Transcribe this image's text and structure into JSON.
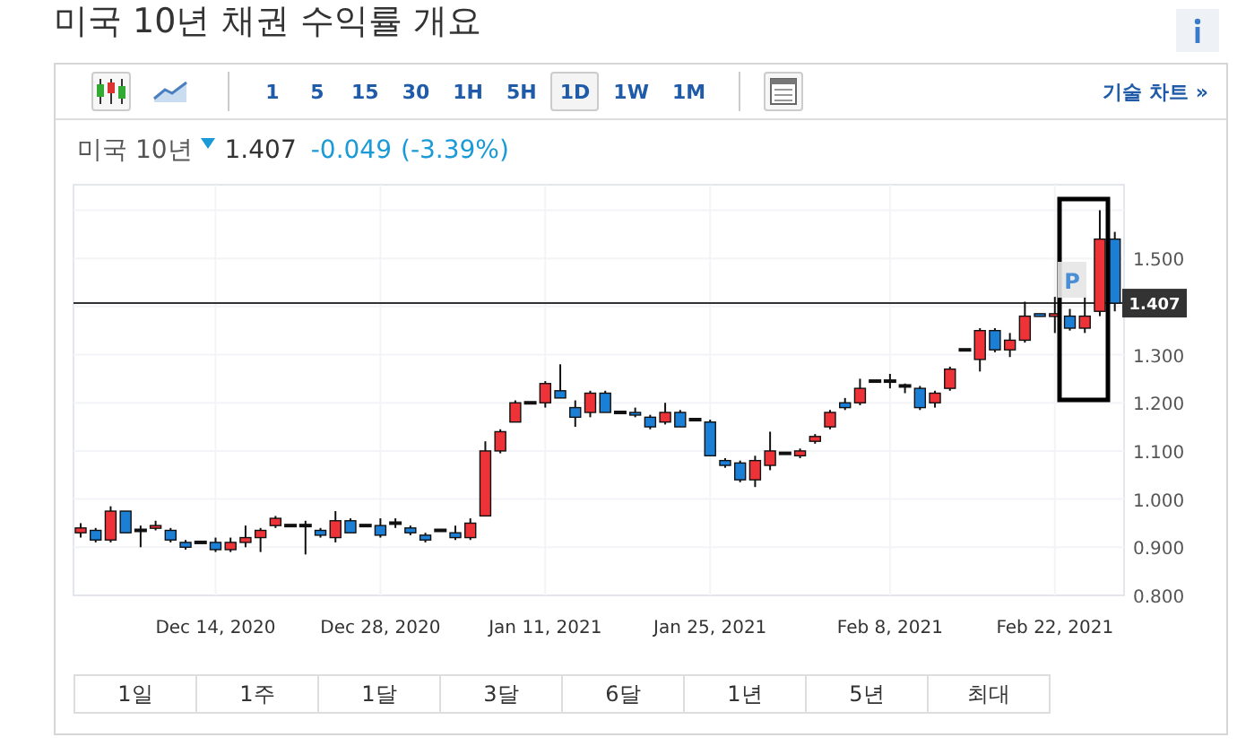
{
  "title": "미국 10년 채권 수익률 개요",
  "toolbar": {
    "chart_types": [
      {
        "kind": "candlestick",
        "selected": true
      },
      {
        "kind": "line",
        "selected": false
      }
    ],
    "intervals": [
      {
        "label": "1",
        "selected": false
      },
      {
        "label": "5",
        "selected": false
      },
      {
        "label": "15",
        "selected": false
      },
      {
        "label": "30",
        "selected": false
      },
      {
        "label": "1H",
        "selected": false
      },
      {
        "label": "5H",
        "selected": false
      },
      {
        "label": "1D",
        "selected": true
      },
      {
        "label": "1W",
        "selected": false
      },
      {
        "label": "1M",
        "selected": false
      }
    ],
    "technical_link": "기술 차트 »"
  },
  "quote": {
    "name": "미국 10년",
    "falling": true,
    "price": "1.407",
    "change": "-0.049",
    "change_pct": "(-3.39%)"
  },
  "chart": {
    "marker": "P",
    "chart_data": {
      "type": "candlestick",
      "categories": [
        null,
        null,
        null,
        null,
        null,
        null,
        null,
        null,
        null,
        "Dec 14, 2020",
        null,
        null,
        null,
        null,
        null,
        null,
        null,
        null,
        null,
        null,
        "Dec 28, 2020",
        null,
        null,
        null,
        null,
        null,
        null,
        null,
        null,
        null,
        null,
        "Jan 11, 2021",
        null,
        null,
        null,
        null,
        null,
        null,
        null,
        null,
        null,
        null,
        "Jan 25, 2021",
        null,
        null,
        null,
        null,
        null,
        null,
        null,
        null,
        null,
        null,
        null,
        "Feb 8, 2021",
        null,
        null,
        null,
        null,
        null,
        null,
        null,
        null,
        null,
        null,
        "Feb 22, 2021",
        null,
        null,
        null,
        null
      ],
      "ohlc": [
        [
          0.93,
          0.95,
          0.92,
          0.94
        ],
        [
          0.935,
          0.94,
          0.91,
          0.915
        ],
        [
          0.915,
          0.985,
          0.91,
          0.975
        ],
        [
          0.975,
          0.975,
          0.93,
          0.93
        ],
        [
          0.935,
          0.945,
          0.9,
          0.935
        ],
        [
          0.94,
          0.955,
          0.935,
          0.945
        ],
        [
          0.935,
          0.94,
          0.91,
          0.915
        ],
        [
          0.91,
          0.915,
          0.895,
          0.9
        ],
        [
          0.91,
          0.91,
          0.91,
          0.91
        ],
        [
          0.91,
          0.92,
          0.89,
          0.895
        ],
        [
          0.895,
          0.92,
          0.89,
          0.91
        ],
        [
          0.91,
          0.945,
          0.9,
          0.92
        ],
        [
          0.92,
          0.94,
          0.89,
          0.935
        ],
        [
          0.945,
          0.965,
          0.94,
          0.96
        ],
        [
          0.945,
          0.945,
          0.945,
          0.945
        ],
        [
          0.945,
          0.955,
          0.885,
          0.945
        ],
        [
          0.935,
          0.94,
          0.92,
          0.925
        ],
        [
          0.92,
          0.975,
          0.91,
          0.955
        ],
        [
          0.955,
          0.96,
          0.93,
          0.93
        ],
        [
          0.945,
          0.945,
          0.945,
          0.945
        ],
        [
          0.945,
          0.96,
          0.92,
          0.925
        ],
        [
          0.95,
          0.96,
          0.94,
          0.95
        ],
        [
          0.94,
          0.945,
          0.925,
          0.93
        ],
        [
          0.925,
          0.93,
          0.91,
          0.915
        ],
        [
          0.935,
          0.935,
          0.935,
          0.935
        ],
        [
          0.93,
          0.945,
          0.915,
          0.92
        ],
        [
          0.92,
          0.96,
          0.915,
          0.95
        ],
        [
          0.965,
          1.12,
          0.965,
          1.1
        ],
        [
          1.1,
          1.145,
          1.095,
          1.14
        ],
        [
          1.16,
          1.205,
          1.16,
          1.2
        ],
        [
          1.2,
          1.2,
          1.2,
          1.2
        ],
        [
          1.2,
          1.245,
          1.19,
          1.24
        ],
        [
          1.225,
          1.28,
          1.21,
          1.21
        ],
        [
          1.19,
          1.205,
          1.15,
          1.17
        ],
        [
          1.18,
          1.225,
          1.17,
          1.22
        ],
        [
          1.22,
          1.225,
          1.18,
          1.18
        ],
        [
          1.18,
          1.18,
          1.18,
          1.18
        ],
        [
          1.18,
          1.19,
          1.17,
          1.175
        ],
        [
          1.17,
          1.175,
          1.145,
          1.15
        ],
        [
          1.16,
          1.2,
          1.155,
          1.18
        ],
        [
          1.18,
          1.185,
          1.15,
          1.15
        ],
        [
          1.165,
          1.165,
          1.165,
          1.165
        ],
        [
          1.16,
          1.165,
          1.09,
          1.09
        ],
        [
          1.08,
          1.085,
          1.065,
          1.07
        ],
        [
          1.075,
          1.08,
          1.035,
          1.04
        ],
        [
          1.04,
          1.09,
          1.025,
          1.08
        ],
        [
          1.07,
          1.14,
          1.06,
          1.1
        ],
        [
          1.095,
          1.095,
          1.095,
          1.095
        ],
        [
          1.09,
          1.105,
          1.085,
          1.1
        ],
        [
          1.12,
          1.135,
          1.115,
          1.13
        ],
        [
          1.15,
          1.185,
          1.145,
          1.18
        ],
        [
          1.2,
          1.21,
          1.185,
          1.19
        ],
        [
          1.2,
          1.25,
          1.195,
          1.23
        ],
        [
          1.245,
          1.245,
          1.245,
          1.245
        ],
        [
          1.245,
          1.26,
          1.23,
          1.245
        ],
        [
          1.235,
          1.24,
          1.22,
          1.235
        ],
        [
          1.23,
          1.235,
          1.185,
          1.19
        ],
        [
          1.2,
          1.225,
          1.19,
          1.22
        ],
        [
          1.23,
          1.275,
          1.225,
          1.27
        ],
        [
          1.31,
          1.31,
          1.31,
          1.31
        ],
        [
          1.29,
          1.355,
          1.265,
          1.35
        ],
        [
          1.35,
          1.355,
          1.305,
          1.31
        ],
        [
          1.31,
          1.345,
          1.295,
          1.33
        ],
        [
          1.33,
          1.41,
          1.325,
          1.38
        ],
        [
          1.385,
          1.385,
          1.38,
          1.38
        ],
        [
          1.38,
          1.42,
          1.345,
          1.385
        ],
        [
          1.38,
          1.395,
          1.35,
          1.355
        ],
        [
          1.355,
          1.42,
          1.345,
          1.38
        ],
        [
          1.39,
          1.6,
          1.38,
          1.54
        ],
        [
          1.54,
          1.555,
          1.39,
          1.407
        ]
      ],
      "ylim": [
        0.8,
        1.653
      ],
      "grid": true,
      "ref_lines": [
        {
          "axis": "y",
          "value": 1.407,
          "label": "1.407"
        }
      ],
      "yticks": [
        {
          "value": 1.5,
          "label": "1.500"
        },
        {
          "value": 1.3,
          "label": "1.300"
        },
        {
          "value": 1.2,
          "label": "1.200"
        },
        {
          "value": 1.1,
          "label": "1.100"
        },
        {
          "value": 1.0,
          "label": "1.000"
        },
        {
          "value": 0.9,
          "label": "0.900"
        },
        {
          "value": 0.8,
          "label": "0.800"
        }
      ]
    }
  },
  "ranges": [
    {
      "label": "1일"
    },
    {
      "label": "1주"
    },
    {
      "label": "1달"
    },
    {
      "label": "3달"
    },
    {
      "label": "6달"
    },
    {
      "label": "1년"
    },
    {
      "label": "5년"
    },
    {
      "label": "최대"
    }
  ]
}
